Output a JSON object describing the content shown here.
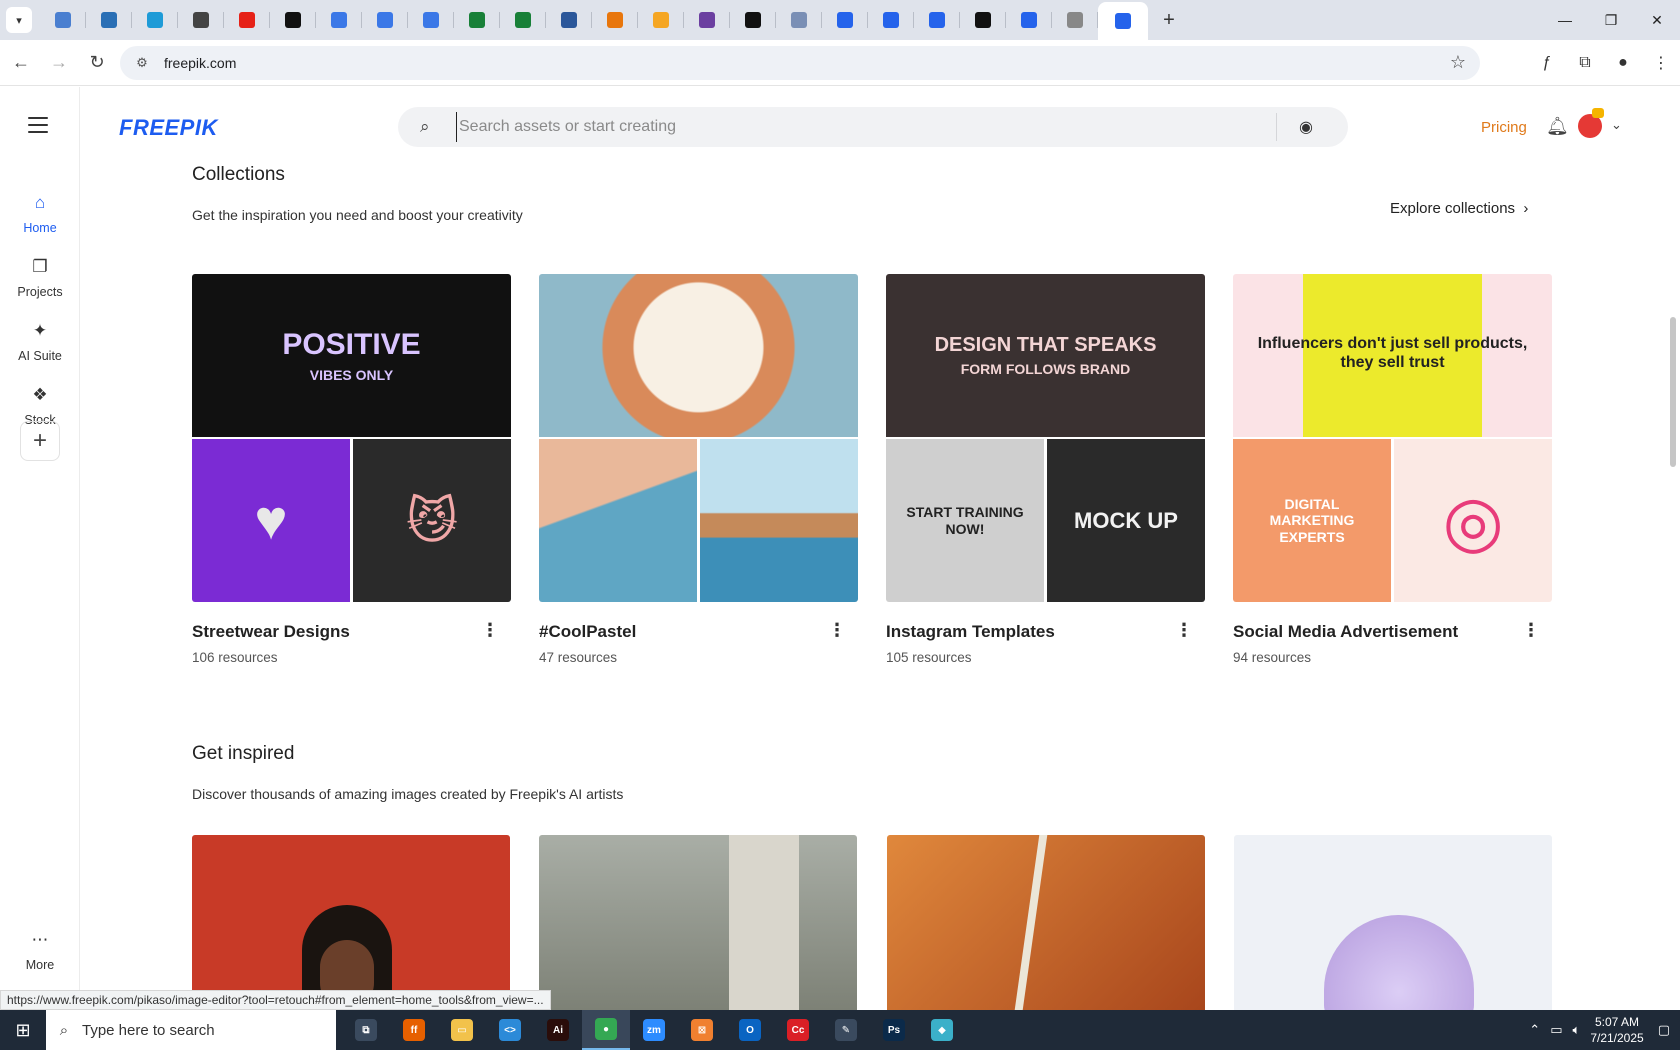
{
  "browser": {
    "url": "freepik.com",
    "tabs": [
      {
        "icon": "globe-icon",
        "color": "#4a7fd0"
      },
      {
        "icon": "vpn-icon",
        "color": "#2a6fb5"
      },
      {
        "icon": "diamond-icon",
        "color": "#1e9bd7"
      },
      {
        "icon": "openai-icon",
        "color": "#444444"
      },
      {
        "icon": "youtube-icon",
        "color": "#e62117"
      },
      {
        "icon": "bolt-icon",
        "color": "#111111"
      },
      {
        "icon": "docs-icon",
        "color": "#3b78e7"
      },
      {
        "icon": "docs-icon",
        "color": "#3b78e7"
      },
      {
        "icon": "docs-icon",
        "color": "#3b78e7"
      },
      {
        "icon": "sheets-icon",
        "color": "#188038"
      },
      {
        "icon": "sheets-icon",
        "color": "#188038"
      },
      {
        "icon": "word-icon",
        "color": "#2b579a"
      },
      {
        "icon": "box-icon",
        "color": "#e8760c"
      },
      {
        "icon": "arrow-icon",
        "color": "#f5a623"
      },
      {
        "icon": "braces-icon",
        "color": "#6b3fa0"
      },
      {
        "icon": "a-icon",
        "color": "#111111"
      },
      {
        "icon": "grid-icon",
        "color": "#7a8fb5"
      },
      {
        "icon": "forms-icon",
        "color": "#2563eb"
      },
      {
        "icon": "forms-icon",
        "color": "#2563eb"
      },
      {
        "icon": "forms-icon",
        "color": "#2563eb"
      },
      {
        "icon": "m-icon",
        "color": "#111111"
      },
      {
        "icon": "forms-icon",
        "color": "#2563eb"
      },
      {
        "icon": "globe-icon",
        "color": "#888888"
      },
      {
        "icon": "forms-icon",
        "color": "#2563eb",
        "active": true
      }
    ],
    "status_url": "https://www.freepik.com/pikaso/image-editor?tool=retouch#from_element=home_tools&from_view=..."
  },
  "sidebar": {
    "items": [
      {
        "label": "Home",
        "icon": "home-icon"
      },
      {
        "label": "Projects",
        "icon": "projects-icon"
      },
      {
        "label": "AI Suite",
        "icon": "sparkle-icon"
      },
      {
        "label": "Stock",
        "icon": "stock-icon"
      }
    ],
    "more_label": "More"
  },
  "header": {
    "logo": "FREEPIK",
    "search_placeholder": "Search assets or start creating",
    "pricing": "Pricing"
  },
  "collections": {
    "title": "Collections",
    "subtitle": "Get the inspiration you need and boost your creativity",
    "explore_label": "Explore collections",
    "items": [
      {
        "name": "Streetwear Designs",
        "count": "106 resources",
        "big": {
          "bg": "#111111",
          "text": "POSITIVE",
          "sub": "VIBES ONLY"
        },
        "s1": {
          "bg": "#7b2bd4",
          "text": "♥"
        },
        "s2": {
          "bg": "#2a2a2a",
          "text": "😼"
        }
      },
      {
        "name": "#CoolPastel",
        "count": "47 resources",
        "big": {
          "bg": "#e8c9a8",
          "text": "",
          "sub": ""
        },
        "s1": {
          "bg": "#8cc3d6",
          "text": ""
        },
        "s2": {
          "bg": "#6fb4cf",
          "text": ""
        }
      },
      {
        "name": "Instagram Templates",
        "count": "105 resources",
        "big": {
          "bg": "#3a3131",
          "text": "DESIGN THAT SPEAKS",
          "sub": "FORM FOLLOWS BRAND"
        },
        "s1": {
          "bg": "#cfcfcf",
          "text": "START TRAINING NOW!"
        },
        "s2": {
          "bg": "#2a2a2a",
          "text": "MOCK UP"
        }
      },
      {
        "name": "Social Media Advertisement",
        "count": "94 resources",
        "big": {
          "bg": "#f6dcdc",
          "text": "Influencers don't just sell products, they sell trust",
          "sub": ""
        },
        "s1": {
          "bg": "#f39a6a",
          "text": "DIGITAL MARKETING EXPERTS"
        },
        "s2": {
          "bg": "#fbe9e4",
          "text": "◎"
        }
      }
    ]
  },
  "inspired": {
    "title": "Get inspired",
    "subtitle": "Discover thousands of amazing images created by Freepik's AI artists",
    "images": [
      {
        "bg": "#c83a27"
      },
      {
        "bg": "#9da49a"
      },
      {
        "bg": "#c7692a"
      },
      {
        "bg": "#eef1f6"
      }
    ]
  },
  "taskbar": {
    "search_placeholder": "Type here to search",
    "time": "5:07 AM",
    "date": "7/21/2025",
    "apps": [
      {
        "icon": "task-view-icon",
        "color": "#3a4a5e",
        "label": "⧉"
      },
      {
        "icon": "firefox-icon",
        "color": "#e66000",
        "label": "ff"
      },
      {
        "icon": "file-explorer-icon",
        "color": "#f2c24b",
        "label": "▭"
      },
      {
        "icon": "vscode-icon",
        "color": "#2c8ad8",
        "label": "<>"
      },
      {
        "icon": "illustrator-icon",
        "color": "#2a0d0a",
        "label": "Ai"
      },
      {
        "icon": "chrome-icon",
        "color": "#34a853",
        "label": "●",
        "active": true
      },
      {
        "icon": "zoom-icon",
        "color": "#2d8cff",
        "label": "zm"
      },
      {
        "icon": "box-app-icon",
        "color": "#f08030",
        "label": "⊠"
      },
      {
        "icon": "outlook-icon",
        "color": "#0a64c2",
        "label": "O"
      },
      {
        "icon": "creative-cloud-icon",
        "color": "#da1f26",
        "label": "Cc"
      },
      {
        "icon": "pen-icon",
        "color": "#3a4a5e",
        "label": "✎"
      },
      {
        "icon": "photoshop-icon",
        "color": "#0b2a4a",
        "label": "Ps"
      },
      {
        "icon": "app-icon",
        "color": "#3bb0c9",
        "label": "◆"
      }
    ]
  }
}
